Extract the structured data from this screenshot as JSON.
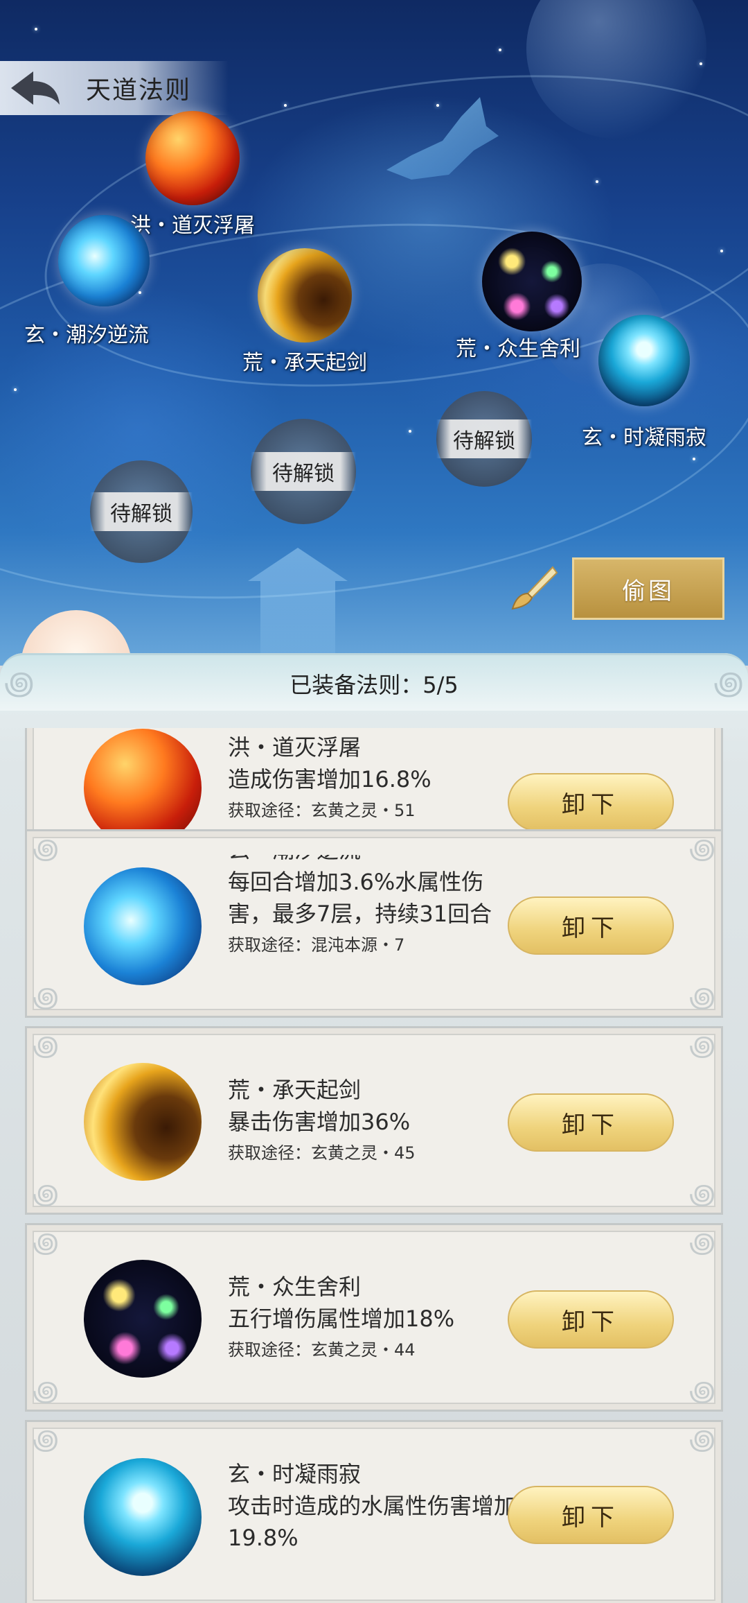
{
  "header": {
    "title": "天道法则",
    "back_icon": "back-arrow-icon"
  },
  "nodes": [
    {
      "id": "hong",
      "label": "洪・道灭浮屠",
      "orb": "fire"
    },
    {
      "id": "xuan1",
      "label": "玄・潮汐逆流",
      "orb": "water"
    },
    {
      "id": "huang1",
      "label": "荒・承天起剑",
      "orb": "gold"
    },
    {
      "id": "huang2",
      "label": "荒・众生舍利",
      "orb": "cosmic"
    },
    {
      "id": "xuan2",
      "label": "玄・时凝雨寂",
      "orb": "drop"
    }
  ],
  "locked": [
    "待解锁",
    "待解锁",
    "待解锁"
  ],
  "actions": {
    "steal_label": "偷图",
    "brush_icon": "brush-icon"
  },
  "panel": {
    "equipped_label": "已装备法则：5/5"
  },
  "cards": [
    {
      "name": "洪・道灭浮屠",
      "desc": "造成伤害增加16.8%",
      "source": "获取途径：玄黄之灵・51",
      "button": "卸下"
    },
    {
      "name": "玄・潮汐逆流",
      "desc": "每回合增加3.6%水属性伤害，最多7层，持续31回合",
      "source": "获取途径：混沌本源・7",
      "button": "卸下"
    },
    {
      "name": "荒・承天起剑",
      "desc": "暴击伤害增加36%",
      "source": "获取途径：玄黄之灵・45",
      "button": "卸下"
    },
    {
      "name": "荒・众生舍利",
      "desc": "五行增伤属性增加18%",
      "source": "获取途径：玄黄之灵・44",
      "button": "卸下"
    },
    {
      "name": "玄・时凝雨寂",
      "desc": "攻击时造成的水属性伤害增加19.8%",
      "source": "",
      "button": "卸下"
    }
  ],
  "colors": {
    "accent_gold": "#c9a452",
    "button_gold": "#efd37c"
  }
}
